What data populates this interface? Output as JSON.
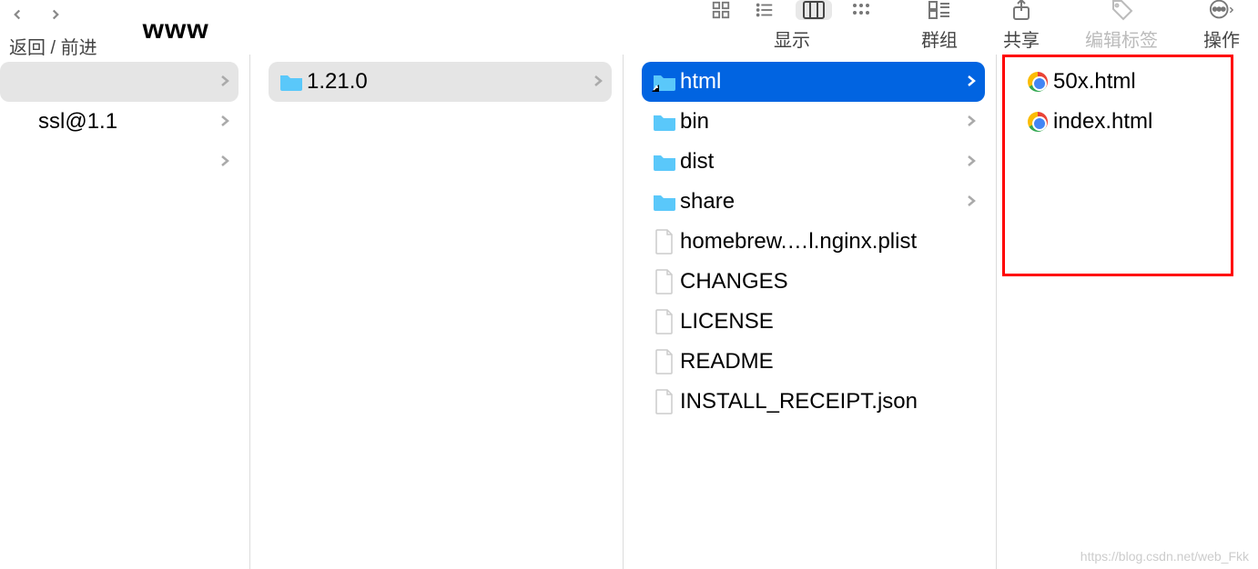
{
  "toolbar": {
    "title": "www",
    "nav_label": "返回 / 前进",
    "view_label": "显示",
    "group_label": "群组",
    "share_label": "共享",
    "tags_label": "编辑标签",
    "actions_label": "操作"
  },
  "col1": {
    "items": [
      {
        "name": "",
        "chev": true,
        "selected": true
      },
      {
        "name": "ssl@1.1",
        "chev": true
      },
      {
        "name": "",
        "chev": true
      }
    ]
  },
  "col2": {
    "items": [
      {
        "name": "1.21.0",
        "type": "folder",
        "chev": true,
        "selected": true
      }
    ]
  },
  "col3": {
    "items": [
      {
        "name": "html",
        "type": "folder",
        "chev": true,
        "selected": "blue"
      },
      {
        "name": "bin",
        "type": "folder",
        "chev": true
      },
      {
        "name": "dist",
        "type": "folder",
        "chev": true
      },
      {
        "name": "share",
        "type": "folder",
        "chev": true
      },
      {
        "name": "homebrew.…l.nginx.plist",
        "type": "file"
      },
      {
        "name": "CHANGES",
        "type": "file"
      },
      {
        "name": "LICENSE",
        "type": "file"
      },
      {
        "name": "README",
        "type": "file"
      },
      {
        "name": "INSTALL_RECEIPT.json",
        "type": "file"
      }
    ]
  },
  "col4": {
    "items": [
      {
        "name": "50x.html",
        "type": "chrome"
      },
      {
        "name": "index.html",
        "type": "chrome"
      }
    ]
  },
  "watermark": "https://blog.csdn.net/web_Fkk"
}
